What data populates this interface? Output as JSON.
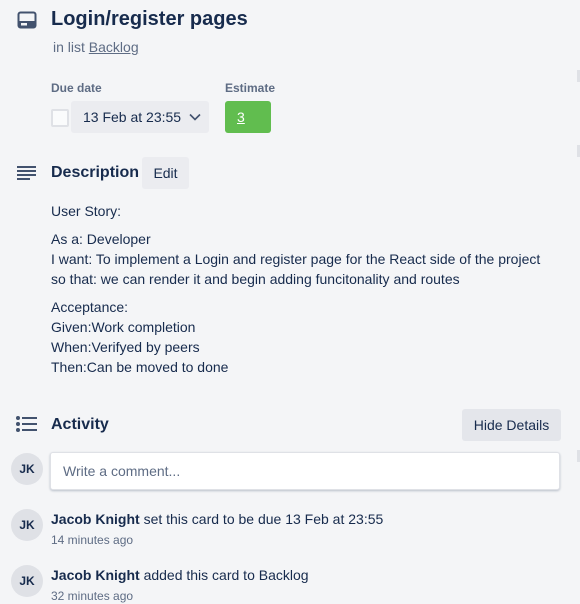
{
  "card": {
    "title": "Login/register pages",
    "in_list_prefix": "in list",
    "list_name": "Backlog"
  },
  "due_date": {
    "label": "Due date",
    "value": "13 Feb at 23:55",
    "checked": false
  },
  "estimate": {
    "label": "Estimate",
    "value": "3",
    "color": "#61bd4f"
  },
  "description": {
    "heading": "Description",
    "edit_label": "Edit",
    "lines": [
      "User Story:",
      "As a: Developer",
      "I want: To implement a Login and register page for the React side of the project",
      "so that: we can render it and begin adding funcitonality and routes",
      "Acceptance:",
      "Given:Work completion",
      "When:Verifyed by peers",
      "Then:Can be moved to done"
    ]
  },
  "activity": {
    "heading": "Activity",
    "hide_details_label": "Hide Details",
    "comment_placeholder": "Write a comment...",
    "current_user_initials": "JK",
    "items": [
      {
        "initials": "JK",
        "user": "Jacob Knight",
        "action": "set this card to be due 13 Feb at 23:55",
        "time": "14 minutes ago"
      },
      {
        "initials": "JK",
        "user": "Jacob Knight",
        "action": "added this card to Backlog",
        "time": "32 minutes ago"
      }
    ]
  },
  "icons": {
    "card": "card-icon",
    "description": "description-icon",
    "activity": "activity-icon",
    "chevron": "chevron-down-icon"
  }
}
